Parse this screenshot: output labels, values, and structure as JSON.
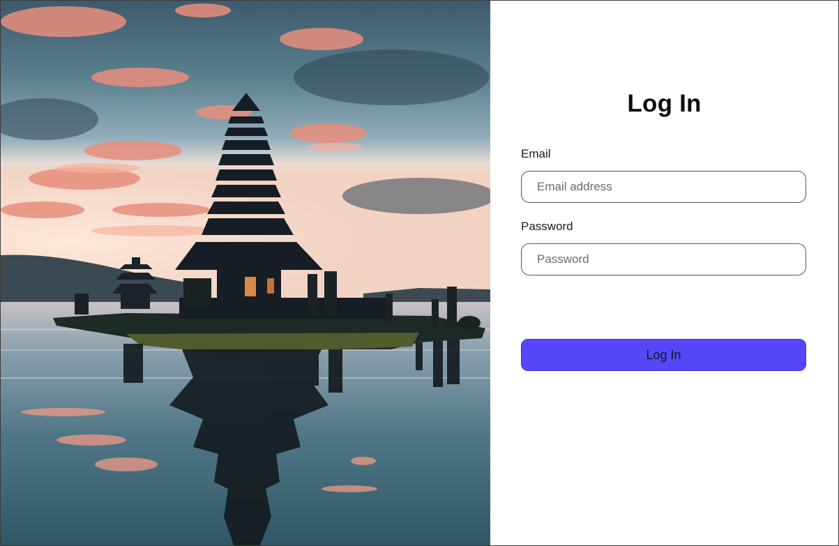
{
  "login": {
    "title": "Log In",
    "email_label": "Email",
    "email_placeholder": "Email address",
    "email_value": "",
    "password_label": "Password",
    "password_placeholder": "Password",
    "password_value": "",
    "submit_label": "Log In"
  },
  "colors": {
    "accent": "#5547f7",
    "field_border": "#555555",
    "title": "#0d0d0d"
  }
}
